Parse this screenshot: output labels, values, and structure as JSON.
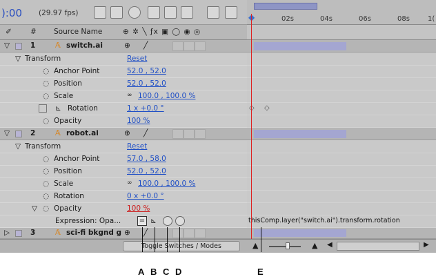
{
  "header": {
    "timecode": "):00",
    "fps": "(29.97 fps)"
  },
  "columns": {
    "source_name": "Source Name",
    "num": "#"
  },
  "timeline": {
    "ticks": [
      "02s",
      "04s",
      "06s",
      "08s",
      "1("
    ],
    "expression_text": "thisComp.layer(\"switch.ai\").transform.rotation"
  },
  "layers": [
    {
      "num": "1",
      "name": "switch.ai",
      "transform_label": "Transform",
      "reset": "Reset",
      "props": [
        {
          "label": "Anchor Point",
          "value": "52.0 , 52.0"
        },
        {
          "label": "Position",
          "value": "52.0 , 52.0"
        },
        {
          "label": "Scale",
          "value": "100.0 , 100.0 %"
        },
        {
          "label": "Rotation",
          "value": "1 x +0.0 °"
        },
        {
          "label": "Opacity",
          "value": "100 %"
        }
      ]
    },
    {
      "num": "2",
      "name": "robot.ai",
      "transform_label": "Transform",
      "reset": "Reset",
      "props": [
        {
          "label": "Anchor Point",
          "value": "57.0 , 58.0"
        },
        {
          "label": "Position",
          "value": "52.0 , 52.0"
        },
        {
          "label": "Scale",
          "value": "100.0 , 100.0 %"
        },
        {
          "label": "Rotation",
          "value": "0 x +0.0 °"
        },
        {
          "label": "Opacity",
          "value": "100 %"
        }
      ],
      "expression_label": "Expression: Opa..."
    },
    {
      "num": "3",
      "name": "sci-fi bkgnd g"
    }
  ],
  "bottom": {
    "toggle_label": "Toggle Switches / Modes"
  },
  "callouts": [
    "A",
    "B",
    "C",
    "D",
    "E"
  ]
}
